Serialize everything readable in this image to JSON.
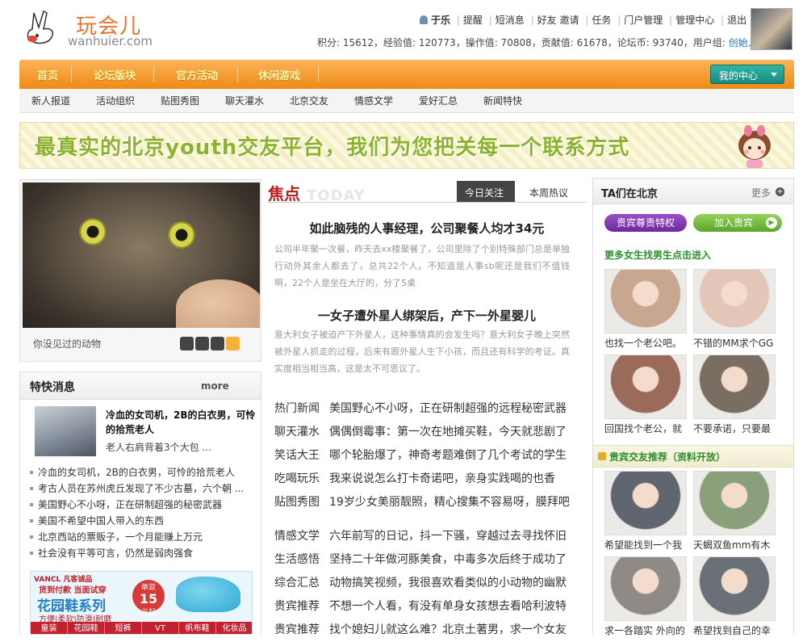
{
  "header": {
    "logo_title": "玩会儿",
    "logo_sub": "wanhuier.com",
    "username": "于乐",
    "links": [
      "提醒",
      "短消息",
      "好友",
      "邀请",
      "任务",
      "门户管理",
      "管理中心",
      "退出"
    ],
    "stats_text": "积分: 15612，经验值: 120773，操作值: 70808，贡献值: 61678，论坛币: 93740，用户组: ",
    "user_group": "创始人"
  },
  "mainnav": {
    "items": [
      "首页",
      "论坛版块",
      "官方活动",
      "休闲游戏"
    ],
    "mycenter": "我的中心"
  },
  "subnav": {
    "items": [
      "新人报道",
      "活动组织",
      "贴图秀图",
      "聊天灌水",
      "北京交友",
      "情感文学",
      "爱好汇总",
      "新闻特快"
    ]
  },
  "banner": {
    "text": "最真实的北京youth交友平台，我们为您把关每一个联系方式"
  },
  "slideshow": {
    "caption": "你没见过的动物",
    "current": 4,
    "total": 4
  },
  "news": {
    "title": "特快消息",
    "more": "more",
    "feature_title": "冷血的女司机，2B的白衣男，可怜的拾荒老人",
    "feature_sub": "老人右肩背着3个大包 ...",
    "items": [
      "冷血的女司机，2B的白衣男，可怜的拾荒老人",
      "考古人员在苏州虎丘发现了不少古墓，六个朝 ...",
      "美国野心不小呀，正在研制超强的秘密武器",
      "美国不希望中国人带入的东西",
      "北京西站的票贩子，一个月能赚上万元",
      "社会没有平等可言，仍然是弱肉强食"
    ],
    "ad": {
      "brand": "VANCL 凡客诚品",
      "promo": "货到付款 当面试穿",
      "series": "花园鞋系列",
      "features": "方便|柔软|防滑|耐磨",
      "price_label": "单双",
      "price": "15",
      "price_unit": "元起",
      "categories": [
        "童装",
        "花园鞋",
        "短裤",
        "VT",
        "帆布鞋",
        "化妆品"
      ]
    }
  },
  "focus": {
    "logo": "焦点",
    "logo_en": "TODAY",
    "tabs": [
      "今日关注",
      "本周热议"
    ],
    "stories": [
      {
        "headline": "如此脑残的人事经理，公司聚餐人均才34元",
        "summary": "公司半年聚一次餐，昨天去xx楼聚餐了，公司里除了个别特殊部门总是单独行动外其余人都去了，总共22个人。不知道是人事sb呢还是我们不值钱啊，22个人是坐在大厅的，分了5桌"
      },
      {
        "headline": "一女子遭外星人绑架后，产下一外星婴儿",
        "summary": "意大利女子被迫产下外星人，这种事情真的会发生吗？意大利女子晚上突然被外星人抓走的过程，后来有跟外星人生下小孩，而且还有科学的考证。真实度相当相当高，这是太不可思议了。"
      }
    ],
    "list1": [
      {
        "cat": "热门新闻",
        "text": "美国野心不小呀，正在研制超强的远程秘密武器"
      },
      {
        "cat": "聊天灌水",
        "text": "偶偶倒霉事：第一次在地摊买鞋，今天就悲剧了"
      },
      {
        "cat": "笑话大王",
        "text": "哪个轮胎爆了，神奇考题难倒了几个考试的学生"
      },
      {
        "cat": "吃喝玩乐",
        "text": "我来说说怎么打卡奇诺吧，亲身实践喝的也香"
      },
      {
        "cat": "贴图秀图",
        "text": "19岁少女美丽靓照，精心搜集不容易呀，膜拜吧"
      }
    ],
    "list2": [
      {
        "cat": "情感文学",
        "text": "六年前写的日记，抖一下骚，穿越过去寻找怀旧"
      },
      {
        "cat": "生活感悟",
        "text": "坚持二十年做河豚美食，中毒多次后终于成功了"
      },
      {
        "cat": "综合汇总",
        "text": "动物搞笑视频，我很喜欢看类似的小动物的幽默"
      },
      {
        "cat": "贵宾推荐",
        "text": "不想一个人看，有没有单身女孩想去看哈利波特"
      },
      {
        "cat": "贵宾推荐",
        "text": "找个媳妇儿就这么难？北京土著男，求一个女友"
      }
    ]
  },
  "sidebar": {
    "title": "TA们在北京",
    "more": "更多",
    "vip_button": "贵宾尊贵特权",
    "join_button": "加入贵宾",
    "tag": "更多女生找男生点击进入",
    "girls": [
      {
        "caption": "也找一个老公吧。",
        "color": "#c8a690"
      },
      {
        "caption": "不错的MM求个GG",
        "color": "#e4c6b8"
      },
      {
        "caption": "回国找个老公，就",
        "color": "#9a6a5a"
      },
      {
        "caption": "不要承诺，只要最",
        "color": "#7a6d62"
      }
    ],
    "section2": "贵宾交友推荐（资料开放）",
    "guys": [
      {
        "caption": "希望能找到一个我",
        "color": "#5f6670"
      },
      {
        "caption": "天蝎双鱼mm有木",
        "color": "#8aa07a"
      },
      {
        "caption": "求一各踏实 外向的",
        "color": "#8f8a86"
      },
      {
        "caption": "希望找到自己的幸",
        "color": "#6a7078"
      }
    ]
  }
}
